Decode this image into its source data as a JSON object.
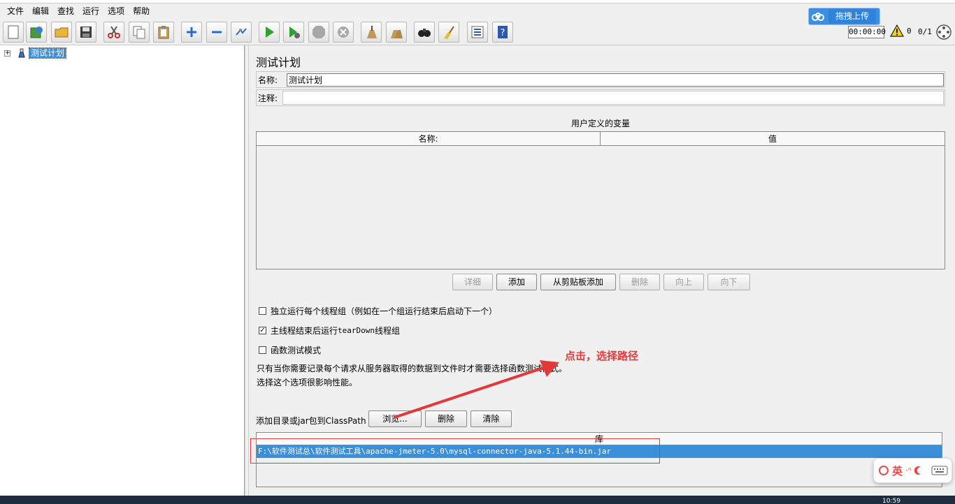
{
  "menu": [
    "文件",
    "编辑",
    "查找",
    "运行",
    "选项",
    "帮助"
  ],
  "toolbar": {
    "icons": [
      "new-icon",
      "templates-icon",
      "open-icon",
      "save-icon",
      "cut-icon",
      "copy-icon",
      "paste-icon",
      "expand-icon",
      "collapse-icon",
      "toggle-icon",
      "start-icon",
      "start-no-pause-icon",
      "stop-icon",
      "shutdown-icon",
      "clear-icon",
      "clear-all-icon",
      "search-icon",
      "reset-search-icon",
      "function-helper-icon",
      "help-icon"
    ],
    "baidu_upload": "拖拽上传",
    "timer": "00:00:00",
    "warning_count": "0",
    "thread_count": "0/1"
  },
  "tree": {
    "root_label": "测试计划"
  },
  "panel": {
    "title": "测试计划",
    "name_label": "名称:",
    "name_value": "测试计划",
    "comment_label": "注释:",
    "comment_value": "",
    "udv_title": "用户定义的变量",
    "udv_col_name": "名称:",
    "udv_col_value": "值",
    "buttons": {
      "detail": "详细",
      "add": "添加",
      "add_from_clipboard": "从剪贴板添加",
      "delete": "删除",
      "up": "向上",
      "down": "向下"
    },
    "options": {
      "serialize": "独立运行每个线程组（例如在一个组运行结束后启动下一个）",
      "teardown_prefix": "主线程结束后运行 ",
      "teardown_mono": "tearDown",
      "teardown_suffix": "线程组",
      "functional": "函数测试模式",
      "serialize_checked": false,
      "teardown_checked": true,
      "functional_checked": false
    },
    "note_line1": "只有当你需要记录每个请求从服务器取得的数据到文件时才需要选择函数测试模式。",
    "note_line2": "选择这个选项很影响性能。",
    "classpath_label": "添加目录或jar包到ClassPath",
    "browse": "浏览...",
    "cp_delete": "删除",
    "cp_clear": "清除",
    "lib_header": "库",
    "lib_rows": [
      "F:\\软件测试总\\软件测试工具\\apache-jmeter-5.0\\mysql-connector-java-5.1.44-bin.jar"
    ]
  },
  "annotation": {
    "text": "点击，选择路径"
  },
  "ime": {
    "lang": "英"
  },
  "clock": "10:59"
}
